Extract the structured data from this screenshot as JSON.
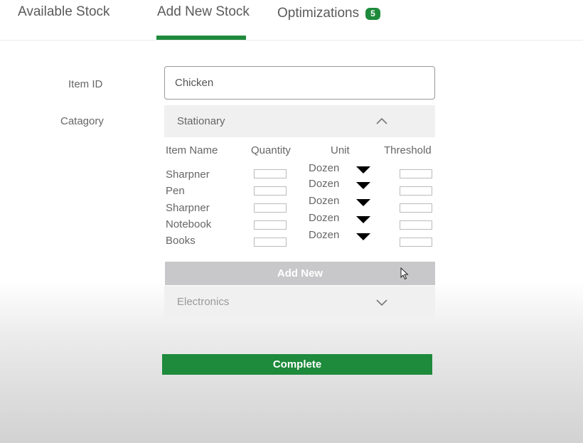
{
  "tabs": {
    "available_stock": "Available Stock",
    "add_new_stock": "Add New Stock",
    "optimizations": "Optimizations",
    "optimizations_count": "5"
  },
  "form": {
    "item_id_label": "Item ID",
    "item_id_value": "Chicken",
    "category_label": "Catagory"
  },
  "categories": {
    "stationary": "Stationary",
    "electronics": "Electronics"
  },
  "table": {
    "headers": [
      "Item Name",
      "Quantity",
      "Unit",
      "Threshold"
    ],
    "rows": [
      {
        "name": "Sharpner",
        "unit": "Dozen"
      },
      {
        "name": "Pen",
        "unit": "Dozen"
      },
      {
        "name": "Sharpner",
        "unit": "Dozen"
      },
      {
        "name": "Notebook",
        "unit": "Dozen"
      },
      {
        "name": "Books",
        "unit": "Dozen"
      }
    ]
  },
  "buttons": {
    "add_new": "Add New",
    "complete": "Complete"
  },
  "colors": {
    "accent_green": "#1e8a3c",
    "add_new_gray": "#c8c8ca"
  }
}
